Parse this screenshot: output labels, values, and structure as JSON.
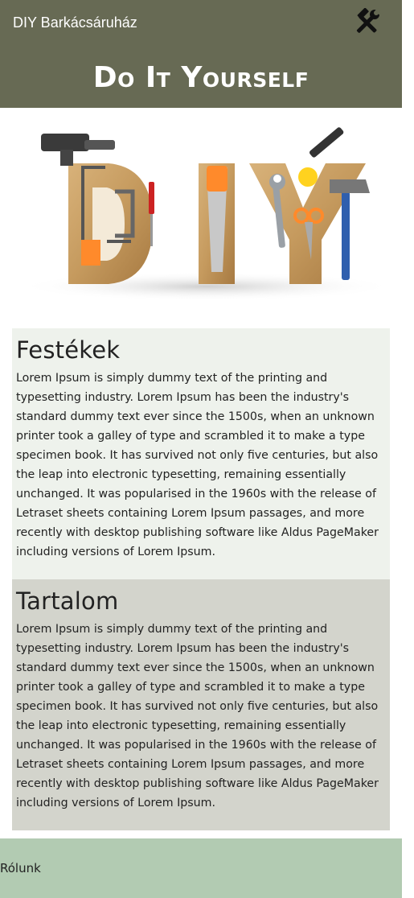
{
  "header": {
    "brand": "DIY Barkácsáruház",
    "title": "Do It Yourself",
    "icon": "tools-icon"
  },
  "hero": {
    "letters": [
      "D",
      "I",
      "Y"
    ],
    "icon": "diy-tools-image"
  },
  "sections": [
    {
      "title": "Festékek",
      "text": "Lorem Ipsum is simply dummy text of the printing and typesetting industry. Lorem Ipsum has been the industry's standard dummy text ever since the 1500s, when an unknown printer took a galley of type and scrambled it to make a type specimen book. It has survived not only five centuries, but also the leap into electronic typesetting, remaining essentially unchanged. It was popularised in the 1960s with the release of Letraset sheets containing Lorem Ipsum passages, and more recently with desktop publishing software like Aldus PageMaker including versions of Lorem Ipsum."
    },
    {
      "title": "Tartalom",
      "text": "Lorem Ipsum is simply dummy text of the printing and typesetting industry. Lorem Ipsum has been the industry's standard dummy text ever since the 1500s, when an unknown printer took a galley of type and scrambled it to make a type specimen book. It has survived not only five centuries, but also the leap into electronic typesetting, remaining essentially unchanged. It was popularised in the 1960s with the release of Letraset sheets containing Lorem Ipsum passages, and more recently with desktop publishing software like Aldus PageMaker including versions of Lorem Ipsum."
    }
  ],
  "footer": {
    "link": "Rólunk"
  },
  "colors": {
    "header_bg": "#676a54",
    "section1_bg": "#eef2ec",
    "section2_bg": "#d3d4cc",
    "footer_bg": "#b2cbb2"
  }
}
